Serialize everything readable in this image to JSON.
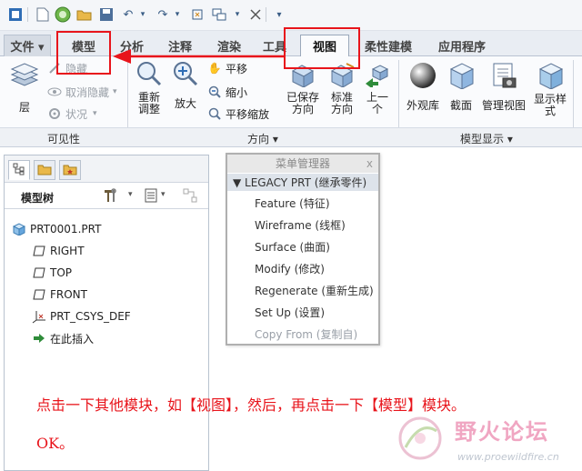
{
  "tabs": [
    {
      "label": "文件 ▾",
      "key": "file"
    },
    {
      "label": "模型",
      "key": "model"
    },
    {
      "label": "分析",
      "key": "analysis"
    },
    {
      "label": "注释",
      "key": "annotate"
    },
    {
      "label": "渲染",
      "key": "render"
    },
    {
      "label": "工具",
      "key": "tools"
    },
    {
      "label": "视图",
      "key": "view"
    },
    {
      "label": "柔性建模",
      "key": "flexible"
    },
    {
      "label": "应用程序",
      "key": "applications"
    }
  ],
  "ribbon": {
    "visibility": {
      "layer": "层",
      "hide": "隐藏",
      "unhide": "取消隐藏",
      "status": "状况",
      "group_label": "可见性 "
    },
    "orientation": {
      "refit": "重新\n调整",
      "zoom_in": "放大",
      "pan": "平移",
      "zoom_out": "缩小",
      "pan_zoom": "平移缩放",
      "saved_orientations": "已保存\n方向",
      "standard_orientation": "标准\n方向",
      "previous": "上一\n个",
      "group_label": "方向 ▾"
    },
    "model_display": {
      "appearance_gallery": "外观库",
      "section": "截面",
      "manage_views": "管理视图",
      "display_style": "显示样\n式",
      "group_label": "模型显示 ▾"
    }
  },
  "model_tree": {
    "title": "模型树",
    "items": [
      {
        "label": "PRT0001.PRT",
        "icon": "part-icon"
      },
      {
        "label": "RIGHT",
        "icon": "datum-plane-icon"
      },
      {
        "label": "TOP",
        "icon": "datum-plane-icon"
      },
      {
        "label": "FRONT",
        "icon": "datum-plane-icon"
      },
      {
        "label": "PRT_CSYS_DEF",
        "icon": "csys-icon"
      },
      {
        "label": "在此插入",
        "icon": "insert-here-icon"
      }
    ]
  },
  "menu_manager": {
    "title": "菜单管理器",
    "close": "x",
    "header": "▼ LEGACY PRT (继承零件)",
    "items": [
      {
        "label": "Feature (特征)",
        "enabled": true
      },
      {
        "label": "Wireframe (线框)",
        "enabled": true
      },
      {
        "label": "Surface (曲面)",
        "enabled": true
      },
      {
        "label": "Modify (修改)",
        "enabled": true
      },
      {
        "label": "Regenerate (重新生成)",
        "enabled": true
      },
      {
        "label": "Set Up (设置)",
        "enabled": true
      },
      {
        "label": "Copy From (复制自)",
        "enabled": false
      }
    ]
  },
  "annotation": {
    "line1": "点击一下其他模块，如【视图】，然后，再点击一下【模型】模块。",
    "line2": "OK。",
    "color": "#e8141b"
  },
  "watermark": {
    "name": "野火论坛",
    "url": "www.proewildfire.cn"
  }
}
